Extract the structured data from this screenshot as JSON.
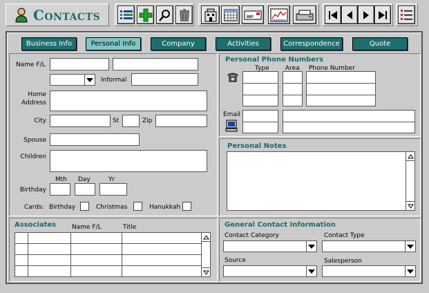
{
  "header": {
    "title": "Contacts"
  },
  "tabs": [
    "Business Info",
    "Personal Info",
    "Company",
    "Activities",
    "Correspondence",
    "Quote"
  ],
  "personal": {
    "name_label": "Name F/L",
    "informal_label": "Informal",
    "home_address_label": "Home\nAddress",
    "city_label": "City",
    "st_label": "St",
    "zip_label": "Zip",
    "spouse_label": "Spouse",
    "children_label": "Children",
    "mth_label": "Mth",
    "day_label": "Day",
    "yr_label": "Yr",
    "birthday_label": "Birthday",
    "cards_label": "Cards:",
    "cards_birthday_label": "Birthday",
    "cards_christmas_label": "Christmas",
    "cards_hanukkah_label": "Hanukkah"
  },
  "phones": {
    "section_title": "Personal Phone Numbers",
    "type_label": "Type",
    "area_label": "Area",
    "number_label": "Phone Number",
    "email_label": "Email"
  },
  "notes": {
    "section_title": "Personal Notes"
  },
  "associates": {
    "section_title": "Associates",
    "col_name": "Name F/L",
    "col_title": "Title"
  },
  "general": {
    "section_title": "General Contact Information",
    "category_label": "Contact Category",
    "type_label": "Contact Type",
    "source_label": "Source",
    "salesperson_label": "Salesperson"
  },
  "colors": {
    "accent": "#1e6e6e",
    "active_tab": "#7ec5c5",
    "section_title": "#1d6a6a"
  }
}
